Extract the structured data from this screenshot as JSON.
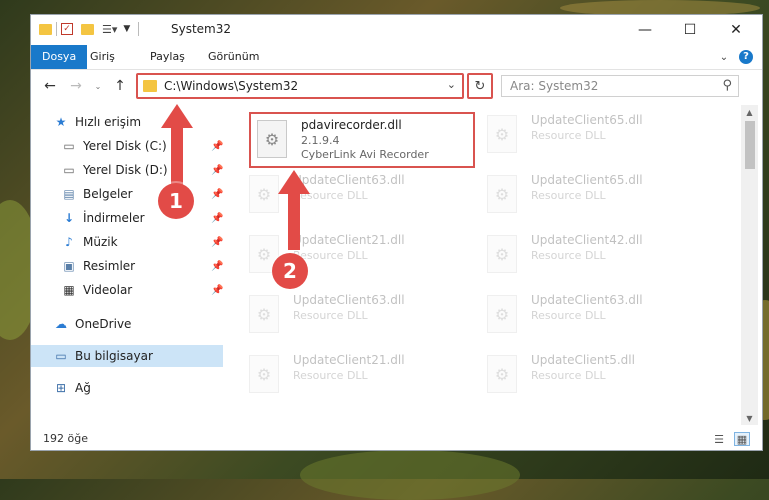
{
  "window": {
    "title": "System32",
    "controls": {
      "minimize": "—",
      "maximize": "☐",
      "close": "✕"
    }
  },
  "ribbon": {
    "tabs": [
      {
        "label": "Dosya",
        "active": true
      },
      {
        "label": "Giriş",
        "active": false
      },
      {
        "label": "Paylaş",
        "active": false
      },
      {
        "label": "Görünüm",
        "active": false
      }
    ]
  },
  "navigation": {
    "address": "C:\\Windows\\System32",
    "search_placeholder": "Ara: System32"
  },
  "sidebar": {
    "items": [
      {
        "label": "Hızlı erişim",
        "icon": "star-icon"
      },
      {
        "label": "Yerel Disk (C:)",
        "icon": "drive-icon",
        "pinned": true
      },
      {
        "label": "Yerel Disk (D:)",
        "icon": "drive-icon",
        "pinned": true
      },
      {
        "label": "Belgeler",
        "icon": "document-icon",
        "pinned": true
      },
      {
        "label": "İndirmeler",
        "icon": "download-icon",
        "pinned": true
      },
      {
        "label": "Müzik",
        "icon": "music-icon",
        "pinned": true
      },
      {
        "label": "Resimler",
        "icon": "picture-icon",
        "pinned": true
      },
      {
        "label": "Videolar",
        "icon": "video-icon",
        "pinned": true
      },
      {
        "label": "OneDrive",
        "icon": "cloud-icon"
      },
      {
        "label": "Bu bilgisayar",
        "icon": "computer-icon",
        "selected": true
      },
      {
        "label": "Ağ",
        "icon": "network-icon"
      }
    ]
  },
  "files": {
    "highlighted": {
      "name": "pdavirecorder.dll",
      "version": "2.1.9.4",
      "description": "CyberLink Avi Recorder"
    },
    "background": [
      {
        "name": "UpdateClient65.dll",
        "type": "Resource DLL"
      },
      {
        "name": "UpdateClient63.dll",
        "type": "Resource DLL"
      },
      {
        "name": "UpdateClient65.dll",
        "type": "Resource DLL"
      },
      {
        "name": "UpdateClient21.dll",
        "type": "Resource DLL"
      },
      {
        "name": "UpdateClient42.dll",
        "type": "Resource DLL"
      },
      {
        "name": "UpdateClient63.dll",
        "type": "Resource DLL"
      },
      {
        "name": "UpdateClient63.dll",
        "type": "Resource DLL"
      },
      {
        "name": "UpdateClient21.dll",
        "type": "Resource DLL"
      },
      {
        "name": "UpdateClient5.dll",
        "type": "Resource DLL"
      }
    ]
  },
  "status": {
    "item_count": "192 öğe"
  },
  "annotations": {
    "step1": "1",
    "step2": "2",
    "color": "#e24b47"
  },
  "colors": {
    "accent": "#1979ca",
    "highlight_border": "#d9534f"
  }
}
